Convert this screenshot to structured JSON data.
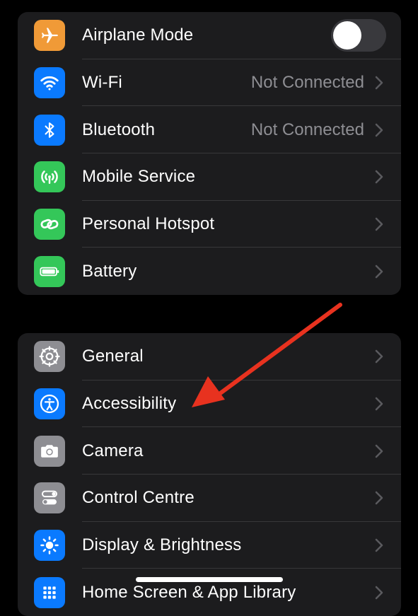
{
  "groups": [
    {
      "rows": [
        {
          "label": "Airplane Mode",
          "icon": "airplane-icon",
          "color": "#f09a37",
          "toggle": true,
          "toggle_on": false
        },
        {
          "label": "Wi-Fi",
          "icon": "wifi-icon",
          "color": "#0a7aff",
          "value": "Not Connected"
        },
        {
          "label": "Bluetooth",
          "icon": "bluetooth-icon",
          "color": "#0a7aff",
          "value": "Not Connected"
        },
        {
          "label": "Mobile Service",
          "icon": "antenna-icon",
          "color": "#34c759"
        },
        {
          "label": "Personal Hotspot",
          "icon": "link-icon",
          "color": "#34c759"
        },
        {
          "label": "Battery",
          "icon": "battery-icon",
          "color": "#34c759"
        }
      ]
    },
    {
      "rows": [
        {
          "label": "General",
          "icon": "gear-icon",
          "color": "#8e8e93"
        },
        {
          "label": "Accessibility",
          "icon": "accessibility-icon",
          "color": "#0a7aff"
        },
        {
          "label": "Camera",
          "icon": "camera-icon",
          "color": "#8e8e93"
        },
        {
          "label": "Control Centre",
          "icon": "toggles-icon",
          "color": "#8e8e93"
        },
        {
          "label": "Display & Brightness",
          "icon": "sun-icon",
          "color": "#0a7aff"
        },
        {
          "label": "Home Screen & App Library",
          "icon": "grid-icon",
          "color": "#0a7aff"
        }
      ]
    }
  ],
  "annotation": {
    "type": "red-arrow",
    "target": "Accessibility",
    "color": "#e8321f"
  }
}
